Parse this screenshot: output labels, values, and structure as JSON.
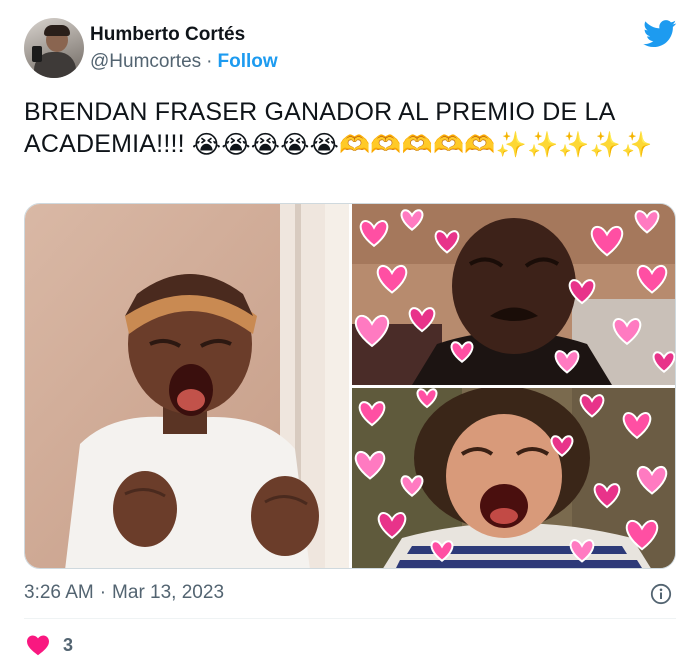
{
  "author": {
    "name": "Humberto Cortés",
    "handle": "@Humcortes",
    "separator": "·",
    "follow_label": "Follow"
  },
  "tweet": {
    "text": "BRENDAN FRASER GANADOR AL PREMIO DE LA ACADEMIA!!!!",
    "emojis": [
      "😭",
      "😭",
      "😭",
      "😭",
      "😭",
      "🫶",
      "🫶",
      "🫶",
      "🫶",
      "🫶",
      "✨",
      "✨",
      "✨",
      "✨",
      "✨"
    ]
  },
  "media": [
    {
      "name": "crying-girl-screaming-image"
    },
    {
      "name": "crying-man-hearts-image"
    },
    {
      "name": "crying-child-hearts-image"
    }
  ],
  "meta": {
    "time": "3:26 AM",
    "separator": "·",
    "date": "Mar 13, 2023"
  },
  "engagement": {
    "likes": "3"
  },
  "colors": {
    "accent": "#1d9bf0",
    "like": "#f91880",
    "secondary_text": "#536471"
  },
  "icons": [
    "twitter-logo-icon",
    "info-icon",
    "heart-icon"
  ]
}
